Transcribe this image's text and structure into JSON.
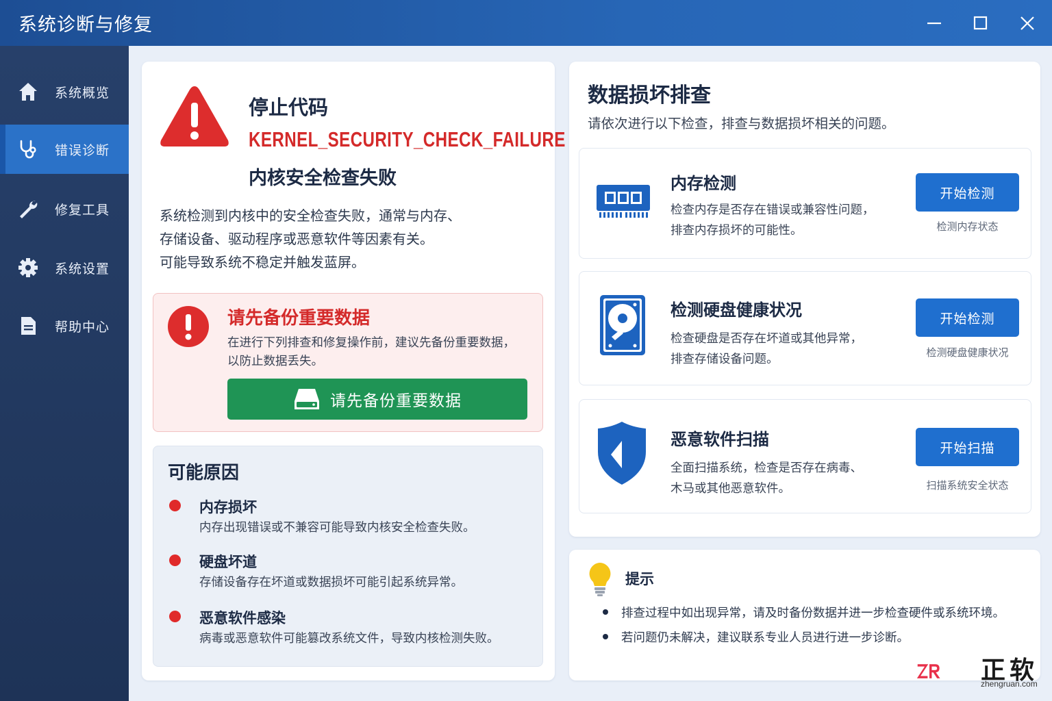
{
  "window": {
    "title": "系统诊断与修复"
  },
  "sidebar": {
    "items": [
      {
        "label": "系统概览",
        "icon": "home-icon"
      },
      {
        "label": "错误诊断",
        "icon": "stethoscope-icon",
        "active": true
      },
      {
        "label": "修复工具",
        "icon": "wrench-icon"
      },
      {
        "label": "系统设置",
        "icon": "gear-icon"
      },
      {
        "label": "帮助中心",
        "icon": "document-icon"
      }
    ]
  },
  "error": {
    "stop_label": "停止代码",
    "stop_code": "KERNEL_SECURITY_CHECK_FAILURE",
    "stop_desc": "内核安全检查失败",
    "description": [
      "系统检测到内核中的安全检查失败，通常与内存、",
      "存储设备、驱动程序或恶意软件等因素有关。",
      "可能导致系统不稳定并触发蓝屏。"
    ]
  },
  "backup_warning": {
    "title": "请先备份重要数据",
    "text": [
      "在进行下列排查和修复操作前，建议先备份重要数据，",
      "以防止数据丢失。"
    ],
    "button_label": "请先备份重要数据"
  },
  "causes": {
    "title": "可能原因",
    "items": [
      {
        "title": "内存损坏",
        "text": "内存出现错误或不兼容可能导致内核安全检查失败。"
      },
      {
        "title": "硬盘坏道",
        "text": "存储设备存在坏道或数据损坏可能引起系统异常。"
      },
      {
        "title": "恶意软件感染",
        "text": "病毒或恶意软件可能篡改系统文件，导致内核检测失败。"
      }
    ]
  },
  "checks": {
    "title": "数据损坏排查",
    "subtitle": "请依次进行以下检查，排查与数据损坏相关的问题。",
    "items": [
      {
        "title": "内存检测",
        "text": [
          "检查内存是否存在错误或兼容性问题，",
          "排查内存损坏的可能性。"
        ],
        "button": "开始检测",
        "caption": "检测内存状态",
        "icon": "memory-icon"
      },
      {
        "title": "检测硬盘健康状况",
        "text": [
          "检查硬盘是否存在坏道或其他异常，",
          "排查存储设备问题。"
        ],
        "button": "开始检测",
        "caption": "检测硬盘健康状况",
        "icon": "harddisk-icon"
      },
      {
        "title": "恶意软件扫描",
        "text": [
          "全面扫描系统，检查是否存在病毒、",
          "木马或其他恶意软件。"
        ],
        "button": "开始扫描",
        "caption": "扫描系统安全状态",
        "icon": "shield-icon"
      }
    ]
  },
  "tips": {
    "title": "提示",
    "items": [
      "排查过程中如出现异常，请及时备份数据并进一步检查硬件或系统环境。",
      "若问题仍未解决，建议联系专业人员进行进一步诊断。"
    ]
  },
  "watermark": {
    "name": "正软",
    "url": "zhengruan.com"
  },
  "colors": {
    "titlebar": "#2766b6",
    "sidebar": "#243b63",
    "active_nav": "#2b72c8",
    "danger": "#d42a2a",
    "success": "#1f9455",
    "primary_button": "#1f6fcf"
  }
}
